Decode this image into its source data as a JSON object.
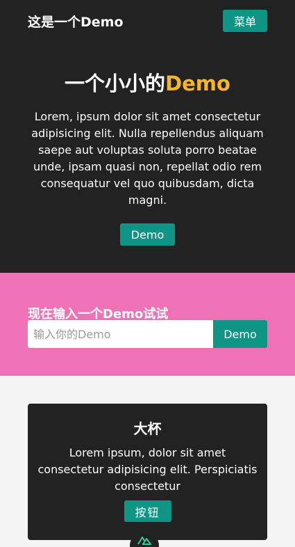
{
  "navbar": {
    "brand": "这是一个Demo",
    "menu_label": "菜单"
  },
  "hero": {
    "title_main": "一个小小的",
    "title_accent": "Demo",
    "text": "Lorem, ipsum dolor sit amet consectetur adipisicing elit. Nulla repellendus aliquam saepe aut voluptas soluta porro beatae unde, ipsam quasi non, repellat odio rem consequatur vel quo quibusdam, dicta magni.",
    "button_label": "Demo"
  },
  "search": {
    "title": "现在输入一个Demo试试",
    "placeholder": "输入你的Demo",
    "value": "",
    "button_label": "Demo"
  },
  "card": {
    "title": "大杯",
    "text": "Lorem ipsum, dolor sit amet consectetur adipisicing elit. Perspiciatis consectetur",
    "button_label": "按钮"
  },
  "colors": {
    "dark": "#222222",
    "teal": "#0e9585",
    "accent": "#f5b629",
    "pink": "#f072b6",
    "light": "#f4f4f4"
  },
  "icons": {
    "floating_badge": "nuxt-icon"
  }
}
